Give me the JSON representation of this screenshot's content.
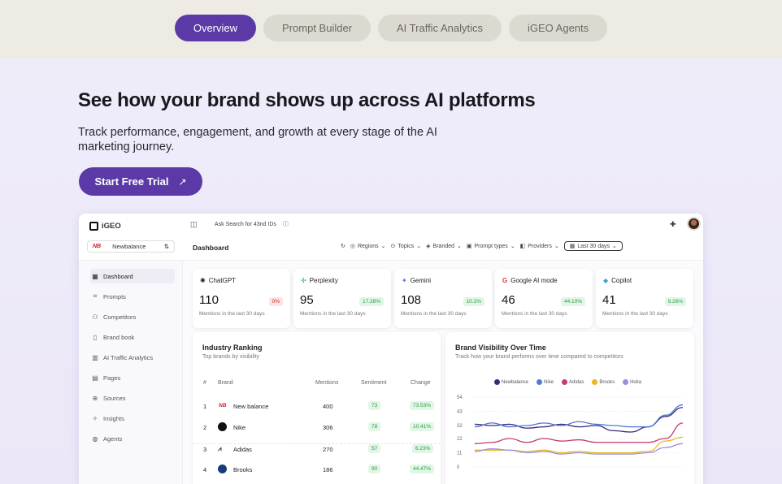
{
  "tabs": [
    "Overview",
    "Prompt Builder",
    "AI Traffic Analytics",
    "iGEO Agents"
  ],
  "hero": {
    "title": "See how your brand shows up across AI platforms",
    "subtitle": "Track performance, engagement, and growth at every stage of the AI marketing journey.",
    "cta": "Start Free Trial",
    "cta_icon": "arrow-up-right-icon"
  },
  "app": {
    "logo": "iGEO",
    "brand_select": "Newbalance",
    "brand_badge": "NB",
    "search": "Ask Search for 43nd IDs",
    "page_title": "Dashboard",
    "filters": [
      "Regions",
      "Topics",
      "Branded",
      "Prompt types",
      "Providers",
      "Last 30 days"
    ],
    "nav": [
      "Dashboard",
      "Prompts",
      "Competitors",
      "Brand book",
      "AI Traffic Analytics",
      "Pages",
      "Sources",
      "Insights",
      "Agents"
    ],
    "cards": [
      {
        "name": "ChatGPT",
        "value": "110",
        "change": "0%",
        "label": "Mentions in the last 30 days",
        "tone": "red"
      },
      {
        "name": "Perplexity",
        "value": "95",
        "change": "17.28%",
        "label": "Mentions in the last 30 days",
        "tone": "green"
      },
      {
        "name": "Gemini",
        "value": "108",
        "change": "10.2%",
        "label": "Mentions in the last 30 days",
        "tone": "green"
      },
      {
        "name": "Google AI mode",
        "value": "46",
        "change": "44.10%",
        "label": "Mentions in the last 30 days",
        "tone": "green"
      },
      {
        "name": "Copilot",
        "value": "41",
        "change": "9.26%",
        "label": "Mentions in the last 30 days",
        "tone": "green"
      }
    ],
    "ranking": {
      "title": "Industry Ranking",
      "subtitle": "Top brands by visibility",
      "headers": [
        "#",
        "Brand",
        "Mentions",
        "Sentiment",
        "Change"
      ],
      "rows": [
        {
          "rank": "1",
          "brand": "New balance",
          "mentions": "400",
          "sentiment": "73",
          "change": "73.53%"
        },
        {
          "rank": "2",
          "brand": "Nike",
          "mentions": "306",
          "sentiment": "78",
          "change": "10.41%"
        },
        {
          "rank": "3",
          "brand": "Adidas",
          "mentions": "270",
          "sentiment": "57",
          "change": "6.23%"
        },
        {
          "rank": "4",
          "brand": "Brooks",
          "mentions": "186",
          "sentiment": "90",
          "change": "44.47%"
        }
      ]
    },
    "visibility": {
      "title": "Brand Visibility Over Time",
      "subtitle": "Track how your brand performs over time compared to competitors",
      "legend": [
        {
          "name": "Newbalance",
          "color": "#3b2a7a"
        },
        {
          "name": "Nike",
          "color": "#4d7bd6"
        },
        {
          "name": "Adidas",
          "color": "#c23a78"
        },
        {
          "name": "Brooks",
          "color": "#e8b923"
        },
        {
          "name": "Hoka",
          "color": "#9a8fe0"
        }
      ],
      "y_ticks": [
        "54",
        "43",
        "32",
        "22",
        "11",
        "0"
      ]
    }
  },
  "chart_data": {
    "type": "line",
    "title": "Brand Visibility Over Time",
    "ylim": [
      0,
      54
    ],
    "y_ticks": [
      0,
      11,
      22,
      32,
      43,
      54
    ],
    "x": [
      1,
      2,
      3,
      4,
      5,
      6,
      7,
      8,
      9,
      10,
      11,
      12,
      13
    ],
    "series": [
      {
        "name": "Newbalance",
        "values": [
          33,
          32,
          33,
          30,
          31,
          33,
          31,
          32,
          28,
          27,
          31,
          39,
          46
        ]
      },
      {
        "name": "Nike",
        "values": [
          31,
          34,
          31,
          32,
          34,
          32,
          35,
          33,
          32,
          31,
          31,
          40,
          48
        ]
      },
      {
        "name": "Adidas",
        "values": [
          18,
          19,
          22,
          19,
          22,
          20,
          21,
          19,
          19,
          19,
          19,
          22,
          34
        ]
      },
      {
        "name": "Brooks",
        "values": [
          13,
          13,
          13,
          12,
          13,
          11,
          12,
          11,
          11,
          11,
          12,
          20,
          23
        ]
      },
      {
        "name": "Hoka",
        "values": [
          12,
          14,
          13,
          11,
          12,
          10,
          11,
          10,
          10,
          10,
          11,
          15,
          18
        ]
      }
    ]
  }
}
